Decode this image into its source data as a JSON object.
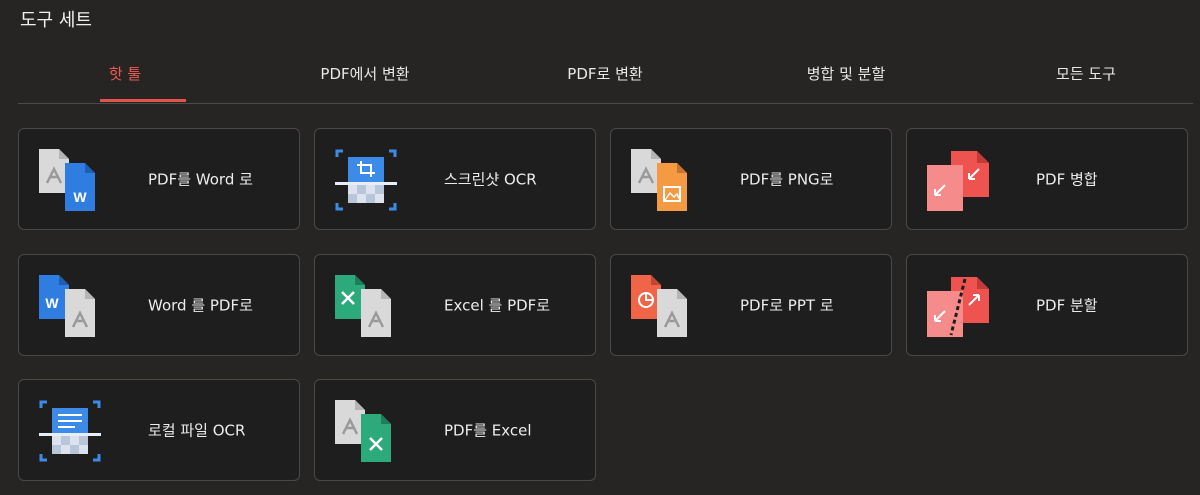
{
  "panel": {
    "title": "도구 세트"
  },
  "tabs": [
    {
      "label": "핫 툴",
      "active": true
    },
    {
      "label": "PDF에서 변환",
      "active": false
    },
    {
      "label": "PDF로 변환",
      "active": false
    },
    {
      "label": "병합 및 분할",
      "active": false
    },
    {
      "label": "모든 도구",
      "active": false
    }
  ],
  "colors": {
    "accent": "#e4534a",
    "word_blue": "#2f7de1",
    "pdf_gray": "#d9d9d9",
    "png_orange": "#f39a43",
    "excel_green": "#2daa7c",
    "ppt_red": "#f06548",
    "merge_red": "#ef5350",
    "ocr_blue": "#3d8be8"
  },
  "tools": [
    {
      "label": "PDF를 Word 로",
      "icon": "pdf-to-word-icon"
    },
    {
      "label": "스크린샷 OCR",
      "icon": "screenshot-ocr-icon"
    },
    {
      "label": "PDF를 PNG로",
      "icon": "pdf-to-png-icon"
    },
    {
      "label": "PDF 병합",
      "icon": "pdf-merge-icon"
    },
    {
      "label": "Word 를 PDF로",
      "icon": "word-to-pdf-icon"
    },
    {
      "label": "Excel 를 PDF로",
      "icon": "excel-to-pdf-icon"
    },
    {
      "label": "PDF로 PPT 로",
      "icon": "pdf-to-ppt-icon"
    },
    {
      "label": "PDF 분할",
      "icon": "pdf-split-icon"
    },
    {
      "label": "로컬 파일 OCR",
      "icon": "local-file-ocr-icon"
    },
    {
      "label": "PDF를 Excel",
      "icon": "pdf-to-excel-icon"
    }
  ]
}
